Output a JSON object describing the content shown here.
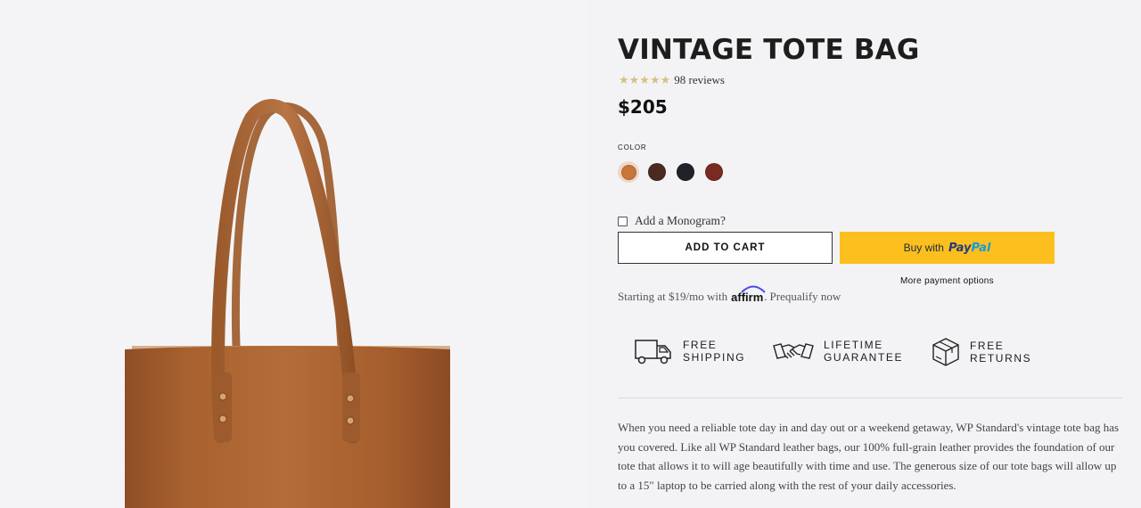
{
  "product": {
    "title": "VINTAGE TOTE BAG",
    "rating": {
      "stars": "★★★★★",
      "value": 5,
      "reviews_text": "98 reviews"
    },
    "price": "$205"
  },
  "color": {
    "label": "COLOR",
    "swatches": [
      {
        "name": "Honey",
        "hex": "#c8763a",
        "selected": true
      },
      {
        "name": "Dark Brown",
        "hex": "#4a2a20",
        "selected": false
      },
      {
        "name": "Black",
        "hex": "#1f2228",
        "selected": false
      },
      {
        "name": "Red",
        "hex": "#7b2a22",
        "selected": false
      }
    ]
  },
  "monogram": {
    "label": "Add a Monogram?",
    "checked": false
  },
  "actions": {
    "add_to_cart": "ADD TO CART",
    "paypal_prefix": "Buy with",
    "paypal_brand_1": "Pay",
    "paypal_brand_2": "Pal",
    "more_payment": "More payment options"
  },
  "financing": {
    "prefix": "Starting at $19/mo with",
    "brand": "affirm",
    "suffix": ".",
    "link": "Prequalify now"
  },
  "features": [
    {
      "icon": "truck-icon",
      "line1": "FREE",
      "line2": "SHIPPING"
    },
    {
      "icon": "handshake-icon",
      "line1": "LIFETIME",
      "line2": "GUARANTEE"
    },
    {
      "icon": "box-icon",
      "line1": "FREE",
      "line2": "RETURNS"
    }
  ],
  "description": "When you need a reliable tote day in and day out or a weekend getaway, WP Standard's vintage tote bag has you covered. Like all WP Standard leather bags, our 100% full-grain leather provides the foundation of our tote that allows it to will age beautifully with time and use. The generous size of our tote bags will allow up to a 15\" laptop to be carried along with the rest of your daily accessories.",
  "colors": {
    "accent_paypal": "#fcbf1e",
    "star": "#d9bf86",
    "leather": "#a86334"
  }
}
